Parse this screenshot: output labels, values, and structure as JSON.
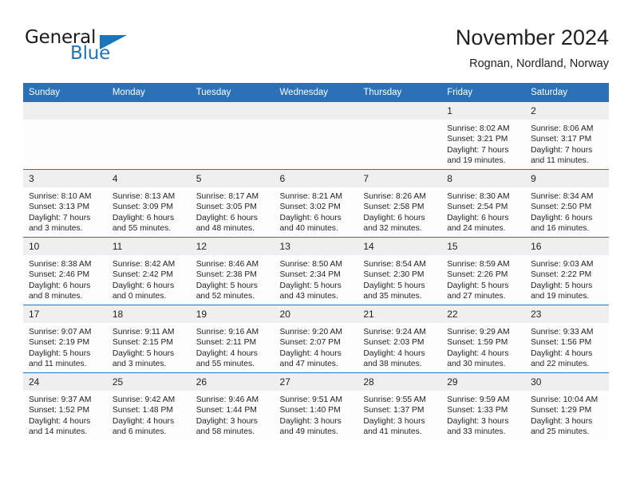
{
  "brand": {
    "name_part1": "General",
    "name_part2": "Blue",
    "accent_color": "#1b75bb"
  },
  "header": {
    "title": "November 2024",
    "location": "Rognan, Nordland, Norway"
  },
  "calendar": {
    "header_bg": "#2b71b8",
    "daynum_bg": "#efefef",
    "weekday_headers": [
      "Sunday",
      "Monday",
      "Tuesday",
      "Wednesday",
      "Thursday",
      "Friday",
      "Saturday"
    ],
    "weeks": [
      [
        {
          "day": "",
          "sunrise": "",
          "sunset": "",
          "daylight": ""
        },
        {
          "day": "",
          "sunrise": "",
          "sunset": "",
          "daylight": ""
        },
        {
          "day": "",
          "sunrise": "",
          "sunset": "",
          "daylight": ""
        },
        {
          "day": "",
          "sunrise": "",
          "sunset": "",
          "daylight": ""
        },
        {
          "day": "",
          "sunrise": "",
          "sunset": "",
          "daylight": ""
        },
        {
          "day": "1",
          "sunrise": "Sunrise: 8:02 AM",
          "sunset": "Sunset: 3:21 PM",
          "daylight": "Daylight: 7 hours and 19 minutes."
        },
        {
          "day": "2",
          "sunrise": "Sunrise: 8:06 AM",
          "sunset": "Sunset: 3:17 PM",
          "daylight": "Daylight: 7 hours and 11 minutes."
        }
      ],
      [
        {
          "day": "3",
          "sunrise": "Sunrise: 8:10 AM",
          "sunset": "Sunset: 3:13 PM",
          "daylight": "Daylight: 7 hours and 3 minutes."
        },
        {
          "day": "4",
          "sunrise": "Sunrise: 8:13 AM",
          "sunset": "Sunset: 3:09 PM",
          "daylight": "Daylight: 6 hours and 55 minutes."
        },
        {
          "day": "5",
          "sunrise": "Sunrise: 8:17 AM",
          "sunset": "Sunset: 3:05 PM",
          "daylight": "Daylight: 6 hours and 48 minutes."
        },
        {
          "day": "6",
          "sunrise": "Sunrise: 8:21 AM",
          "sunset": "Sunset: 3:02 PM",
          "daylight": "Daylight: 6 hours and 40 minutes."
        },
        {
          "day": "7",
          "sunrise": "Sunrise: 8:26 AM",
          "sunset": "Sunset: 2:58 PM",
          "daylight": "Daylight: 6 hours and 32 minutes."
        },
        {
          "day": "8",
          "sunrise": "Sunrise: 8:30 AM",
          "sunset": "Sunset: 2:54 PM",
          "daylight": "Daylight: 6 hours and 24 minutes."
        },
        {
          "day": "9",
          "sunrise": "Sunrise: 8:34 AM",
          "sunset": "Sunset: 2:50 PM",
          "daylight": "Daylight: 6 hours and 16 minutes."
        }
      ],
      [
        {
          "day": "10",
          "sunrise": "Sunrise: 8:38 AM",
          "sunset": "Sunset: 2:46 PM",
          "daylight": "Daylight: 6 hours and 8 minutes."
        },
        {
          "day": "11",
          "sunrise": "Sunrise: 8:42 AM",
          "sunset": "Sunset: 2:42 PM",
          "daylight": "Daylight: 6 hours and 0 minutes."
        },
        {
          "day": "12",
          "sunrise": "Sunrise: 8:46 AM",
          "sunset": "Sunset: 2:38 PM",
          "daylight": "Daylight: 5 hours and 52 minutes."
        },
        {
          "day": "13",
          "sunrise": "Sunrise: 8:50 AM",
          "sunset": "Sunset: 2:34 PM",
          "daylight": "Daylight: 5 hours and 43 minutes."
        },
        {
          "day": "14",
          "sunrise": "Sunrise: 8:54 AM",
          "sunset": "Sunset: 2:30 PM",
          "daylight": "Daylight: 5 hours and 35 minutes."
        },
        {
          "day": "15",
          "sunrise": "Sunrise: 8:59 AM",
          "sunset": "Sunset: 2:26 PM",
          "daylight": "Daylight: 5 hours and 27 minutes."
        },
        {
          "day": "16",
          "sunrise": "Sunrise: 9:03 AM",
          "sunset": "Sunset: 2:22 PM",
          "daylight": "Daylight: 5 hours and 19 minutes."
        }
      ],
      [
        {
          "day": "17",
          "sunrise": "Sunrise: 9:07 AM",
          "sunset": "Sunset: 2:19 PM",
          "daylight": "Daylight: 5 hours and 11 minutes."
        },
        {
          "day": "18",
          "sunrise": "Sunrise: 9:11 AM",
          "sunset": "Sunset: 2:15 PM",
          "daylight": "Daylight: 5 hours and 3 minutes."
        },
        {
          "day": "19",
          "sunrise": "Sunrise: 9:16 AM",
          "sunset": "Sunset: 2:11 PM",
          "daylight": "Daylight: 4 hours and 55 minutes."
        },
        {
          "day": "20",
          "sunrise": "Sunrise: 9:20 AM",
          "sunset": "Sunset: 2:07 PM",
          "daylight": "Daylight: 4 hours and 47 minutes."
        },
        {
          "day": "21",
          "sunrise": "Sunrise: 9:24 AM",
          "sunset": "Sunset: 2:03 PM",
          "daylight": "Daylight: 4 hours and 38 minutes."
        },
        {
          "day": "22",
          "sunrise": "Sunrise: 9:29 AM",
          "sunset": "Sunset: 1:59 PM",
          "daylight": "Daylight: 4 hours and 30 minutes."
        },
        {
          "day": "23",
          "sunrise": "Sunrise: 9:33 AM",
          "sunset": "Sunset: 1:56 PM",
          "daylight": "Daylight: 4 hours and 22 minutes."
        }
      ],
      [
        {
          "day": "24",
          "sunrise": "Sunrise: 9:37 AM",
          "sunset": "Sunset: 1:52 PM",
          "daylight": "Daylight: 4 hours and 14 minutes."
        },
        {
          "day": "25",
          "sunrise": "Sunrise: 9:42 AM",
          "sunset": "Sunset: 1:48 PM",
          "daylight": "Daylight: 4 hours and 6 minutes."
        },
        {
          "day": "26",
          "sunrise": "Sunrise: 9:46 AM",
          "sunset": "Sunset: 1:44 PM",
          "daylight": "Daylight: 3 hours and 58 minutes."
        },
        {
          "day": "27",
          "sunrise": "Sunrise: 9:51 AM",
          "sunset": "Sunset: 1:40 PM",
          "daylight": "Daylight: 3 hours and 49 minutes."
        },
        {
          "day": "28",
          "sunrise": "Sunrise: 9:55 AM",
          "sunset": "Sunset: 1:37 PM",
          "daylight": "Daylight: 3 hours and 41 minutes."
        },
        {
          "day": "29",
          "sunrise": "Sunrise: 9:59 AM",
          "sunset": "Sunset: 1:33 PM",
          "daylight": "Daylight: 3 hours and 33 minutes."
        },
        {
          "day": "30",
          "sunrise": "Sunrise: 10:04 AM",
          "sunset": "Sunset: 1:29 PM",
          "daylight": "Daylight: 3 hours and 25 minutes."
        }
      ]
    ]
  }
}
